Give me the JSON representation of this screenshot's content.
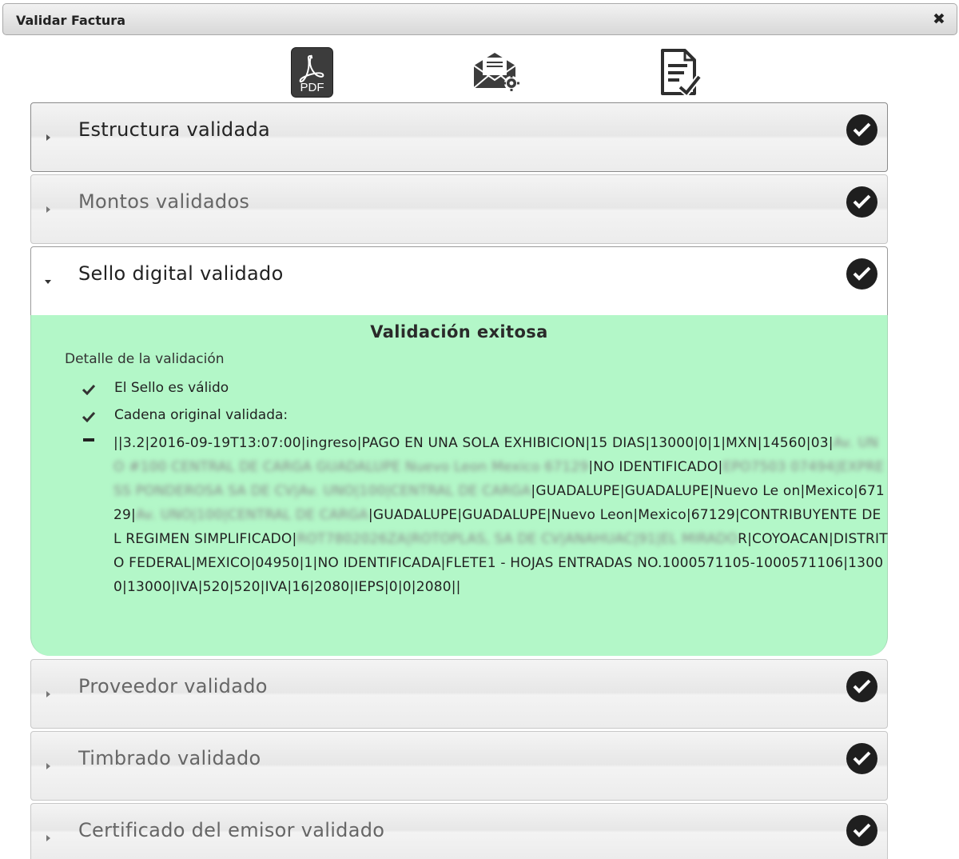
{
  "window": {
    "title": "Validar Factura",
    "close_icon": "close-icon"
  },
  "toolbar": {
    "pdf_label": "PDF",
    "icons": [
      "pdf-icon",
      "mail-settings-icon",
      "document-check-icon"
    ]
  },
  "sections": [
    {
      "label": "Estructura validada",
      "status": "check-icon"
    },
    {
      "label": "Montos validados",
      "status": "check-icon"
    },
    {
      "label": "Sello digital validado",
      "status": "check-icon",
      "expanded": true
    },
    {
      "label": "Proveedor validado",
      "status": "check-icon"
    },
    {
      "label": "Timbrado validado",
      "status": "check-icon"
    },
    {
      "label": "Certificado del emisor validado",
      "status": "check-icon"
    }
  ],
  "sello_panel": {
    "title": "Validación exitosa",
    "subtitle": "Detalle de la validación",
    "items": [
      "El Sello es válido",
      "Cadena original validada:"
    ],
    "cadena": {
      "p1": "||3.2|2016-09-19T13:07:00|ingreso|PAGO EN UNA SOLA EXHIBICION|15 DIAS|13000|0|1|MXN|14560|03|",
      "b1": "Av. UNO #100 CENTRAL DE CARGA GUADALUPE Nuevo Leon Mexico 67129",
      "p2": "|NO IDENTIFICADO|",
      "b2": "EPO7503 07494|EXPRESS PONDEROSA SA DE CV|Av. UNO|100|CENTRAL DE CARGA",
      "p3": "|GUADALUPE|GUADALUPE|Nuevo Le on|Mexico|67129|",
      "b3": "Av. UNO|100|CENTRAL DE CARGA",
      "p4": "|GUADALUPE|GUADALUPE|Nuevo Leon|Mexico|67129|CONTRIBUYENTE DEL REGIMEN SIMPLIFICADO|",
      "b4": "ROT7802026ZA|ROTOPLAS, SA DE CV|ANAHUAC|91|EL MIRADO",
      "p5": "R|COYOACAN|DISTRITO FEDERAL|MEXICO|04950|1|NO IDENTIFICADA|FLETE1 - HOJAS ENTRADAS NO.1000571105-1000571106|13000|13000|IVA|520|520|IVA|16|2080|IEPS|0|0|2080||"
    }
  },
  "colors": {
    "success_panel": "#b3f7c8",
    "badge": "#1f1f1f",
    "header_text": "#222222",
    "muted_text": "#666666"
  }
}
